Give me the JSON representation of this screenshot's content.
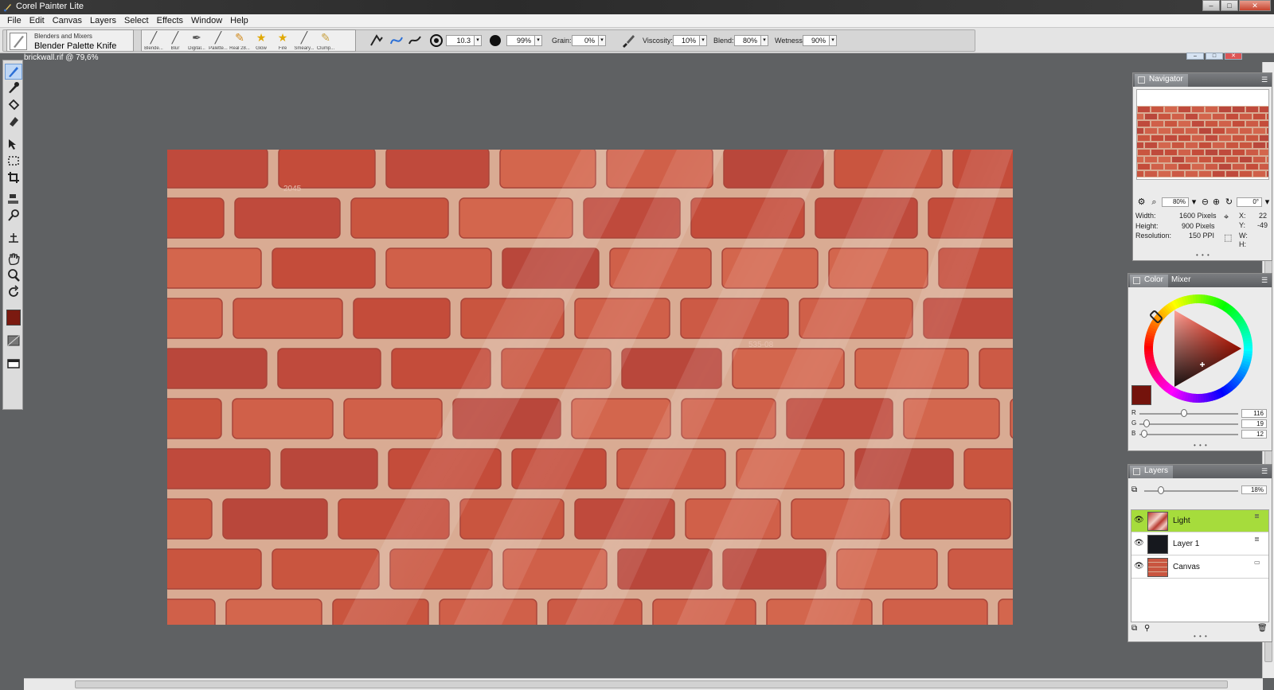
{
  "window": {
    "title": "Corel Painter Lite",
    "controls": [
      "–",
      "□",
      "✕"
    ]
  },
  "menu": [
    "File",
    "Edit",
    "Canvas",
    "Layers",
    "Select",
    "Effects",
    "Window",
    "Help"
  ],
  "brush": {
    "category": "Blenders and Mixers",
    "variant": "Blender Palette Knife"
  },
  "recent_brushes": [
    {
      "label": "Blende...",
      "glyph": "╱"
    },
    {
      "label": "Blur",
      "glyph": "╱"
    },
    {
      "label": "Digital...",
      "glyph": "✒"
    },
    {
      "label": "Palette...",
      "glyph": "╱"
    },
    {
      "label": "Real 28...",
      "glyph": "✎"
    },
    {
      "label": "Glow",
      "glyph": "★"
    },
    {
      "label": "Fire",
      "glyph": "★"
    },
    {
      "label": "Smeary...",
      "glyph": "╱"
    },
    {
      "label": "Clump...",
      "glyph": "✎"
    }
  ],
  "properties": {
    "size": "10.3",
    "opacity": "99%",
    "grain_label": "Grain:",
    "grain": "0%",
    "viscosity_label": "Viscosity:",
    "viscosity": "10%",
    "blend_label": "Blend:",
    "blend": "80%",
    "wetness_label": "Wetness:",
    "wetness": "90%"
  },
  "document": {
    "tab_title": "brickwall.rif @ 79,6%"
  },
  "navigator": {
    "title": "Navigator",
    "zoom": "80%",
    "rotation": "0°",
    "width_label": "Width:",
    "width": "1600 Pixels",
    "height_label": "Height:",
    "height": "900 Pixels",
    "resolution_label": "Resolution:",
    "resolution": "150 PPI",
    "x_label": "X:",
    "x": "22",
    "y_label": "Y:",
    "y": "-49",
    "w_label": "W:",
    "h_label": "H:"
  },
  "color": {
    "tabs": [
      "Color",
      "Mixer"
    ],
    "current_hex": "#74130c",
    "r_label": "R",
    "r": "116",
    "r_level": 116,
    "g_label": "G",
    "g": "19",
    "g_level": 19,
    "b_label": "B",
    "b": "12",
    "b_level": 12
  },
  "layers": {
    "title": "Layers",
    "opacity": "18%",
    "opacity_level": 18,
    "items": [
      {
        "name": "Light",
        "selected": true
      },
      {
        "name": "Layer 1",
        "selected": false
      },
      {
        "name": "Canvas",
        "selected": false
      }
    ]
  },
  "artwork_text": {
    "stamp1": "2045",
    "stamp2": "535-08"
  },
  "accent": {
    "selection_green": "#a6dc3c",
    "brick": "#c95a46",
    "mortar": "#d9ab93"
  }
}
